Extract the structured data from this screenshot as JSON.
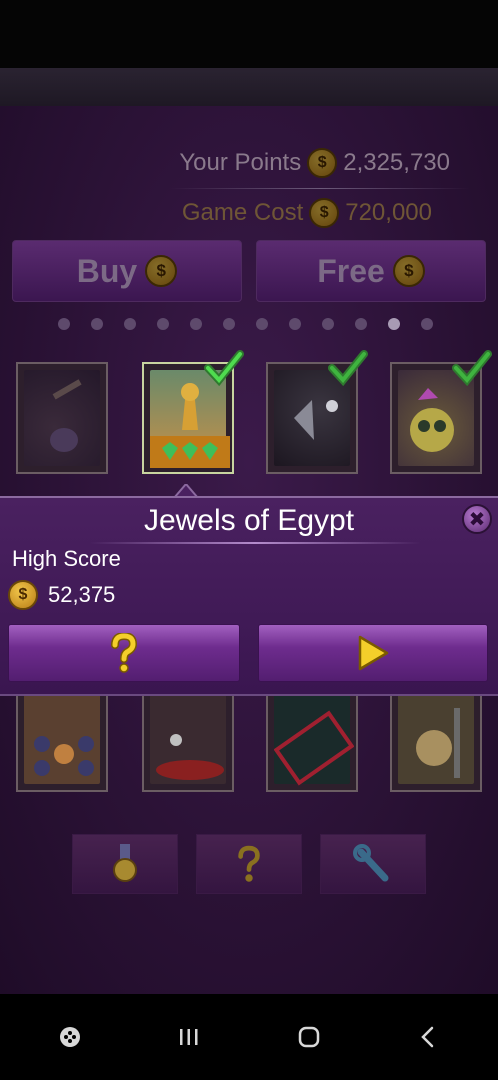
{
  "points": {
    "your_points_label": "Your Points",
    "your_points_value": "2,325,730",
    "game_cost_label": "Game Cost",
    "game_cost_value": "720,000"
  },
  "buttons": {
    "buy_label": "Buy",
    "free_label": "Free"
  },
  "coin_symbol": "$",
  "pager": {
    "count": 12,
    "active_index": 10
  },
  "popup": {
    "title": "Jewels of Egypt",
    "high_score_label": "High Score",
    "high_score_value": "52,375",
    "close_symbol": "✖"
  },
  "colors": {
    "accent_purple": "#6e2c8e",
    "coin_gold": "#f2c64a",
    "check_green": "#3fbf3f"
  },
  "icons": {
    "help": "question-icon",
    "play": "play-icon",
    "medal": "medal-icon",
    "wrench": "wrench-icon"
  }
}
